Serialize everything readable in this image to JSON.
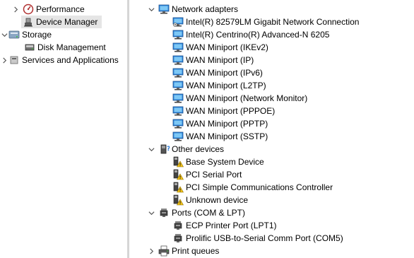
{
  "left_tree": {
    "performance": "Performance",
    "device_manager": "Device Manager",
    "storage": "Storage",
    "disk_management": "Disk Management",
    "services_and_applications": "Services and Applications"
  },
  "device_tree": {
    "network_adapters": {
      "label": "Network adapters",
      "items": [
        "Intel(R) 82579LM Gigabit Network Connection",
        "Intel(R) Centrino(R) Advanced-N 6205",
        "WAN Miniport (IKEv2)",
        "WAN Miniport (IP)",
        "WAN Miniport (IPv6)",
        "WAN Miniport (L2TP)",
        "WAN Miniport (Network Monitor)",
        "WAN Miniport (PPPOE)",
        "WAN Miniport (PPTP)",
        "WAN Miniport (SSTP)"
      ]
    },
    "other_devices": {
      "label": "Other devices",
      "items": [
        "Base System Device",
        "PCI Serial Port",
        "PCI Simple Communications Controller",
        "Unknown device"
      ]
    },
    "ports": {
      "label": "Ports (COM & LPT)",
      "items": [
        "ECP Printer Port (LPT1)",
        "Prolific USB-to-Serial Comm Port (COM5)"
      ]
    },
    "print_queues": {
      "label": "Print queues"
    }
  },
  "icons": {
    "network_adapter": "network-adapter-icon",
    "warning_device": "unknown-device-warning-icon",
    "port": "port-connector-icon",
    "printer": "printer-icon"
  },
  "colors": {
    "selection": "#e5e5e5",
    "splitter": "#d6d6d6",
    "monitor_blue": "#2e86de",
    "warning_yellow": "#f5c518"
  }
}
